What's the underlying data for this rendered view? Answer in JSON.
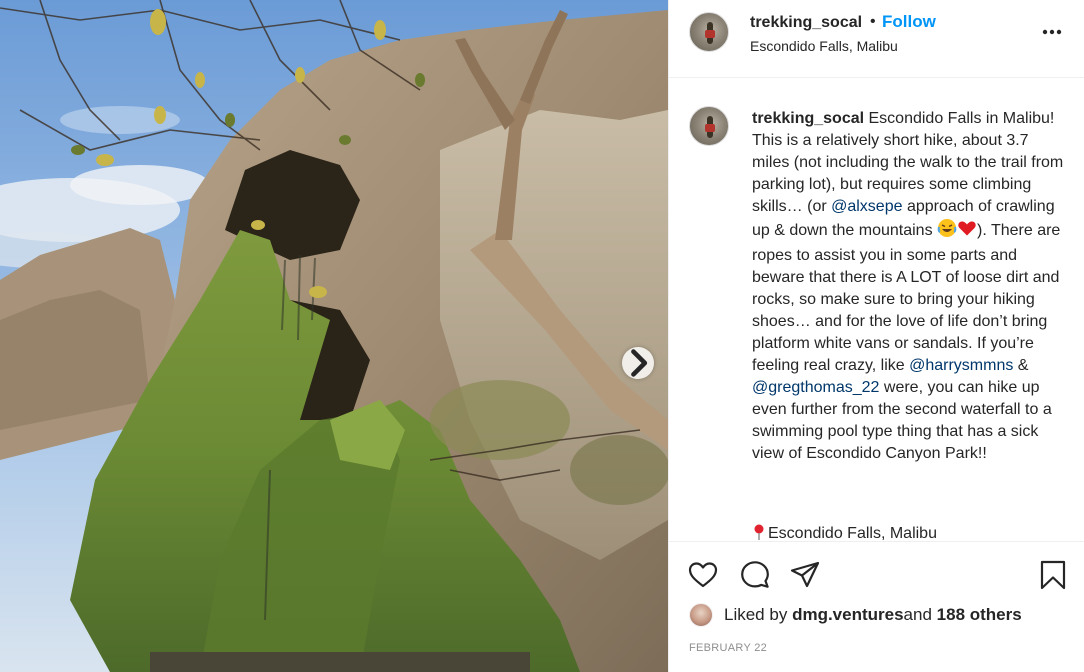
{
  "post": {
    "username": "trekking_socal",
    "separator": "•",
    "follow_label": "Follow",
    "location": "Escondido Falls, Malibu"
  },
  "caption": {
    "username": "trekking_socal",
    "part1": " Escondido Falls in Malibu! This is a relatively short hike, about 3.7 miles (not including the walk to the trail from parking lot), but requires some climbing skills… (or ",
    "mention1": "@alxsepe",
    "part2": " approach of crawling up & down the mountains ",
    "part3": "). There are ropes to assist you in some parts and beware that there is A LOT of loose dirt and rocks, so make sure to bring your hiking shoes… and for the love of life don’t bring platform white vans or sandals. If you’re feeling real crazy, like ",
    "mention2": "@harrysmmns",
    "part4": " & ",
    "mention3": "@gregthomas_22",
    "part5": " were, you can hike up even further from the second waterfall to a swimming pool type thing that has a sick view of Escondido Canyon Park!!",
    "emojis": [
      "laughing-tears-emoji",
      "red-heart-emoji"
    ],
    "place_line": "Escondido Falls, Malibu"
  },
  "actions": {
    "icons": [
      "heart-icon",
      "comment-icon",
      "share-icon",
      "bookmark-icon"
    ]
  },
  "likes": {
    "prefix": "Liked by ",
    "user": "dmg.ventures",
    "middle": " and ",
    "others": "188 others"
  },
  "date": "FEBRUARY 22",
  "photo": {
    "description_icons": [
      "carousel-next-icon"
    ]
  }
}
